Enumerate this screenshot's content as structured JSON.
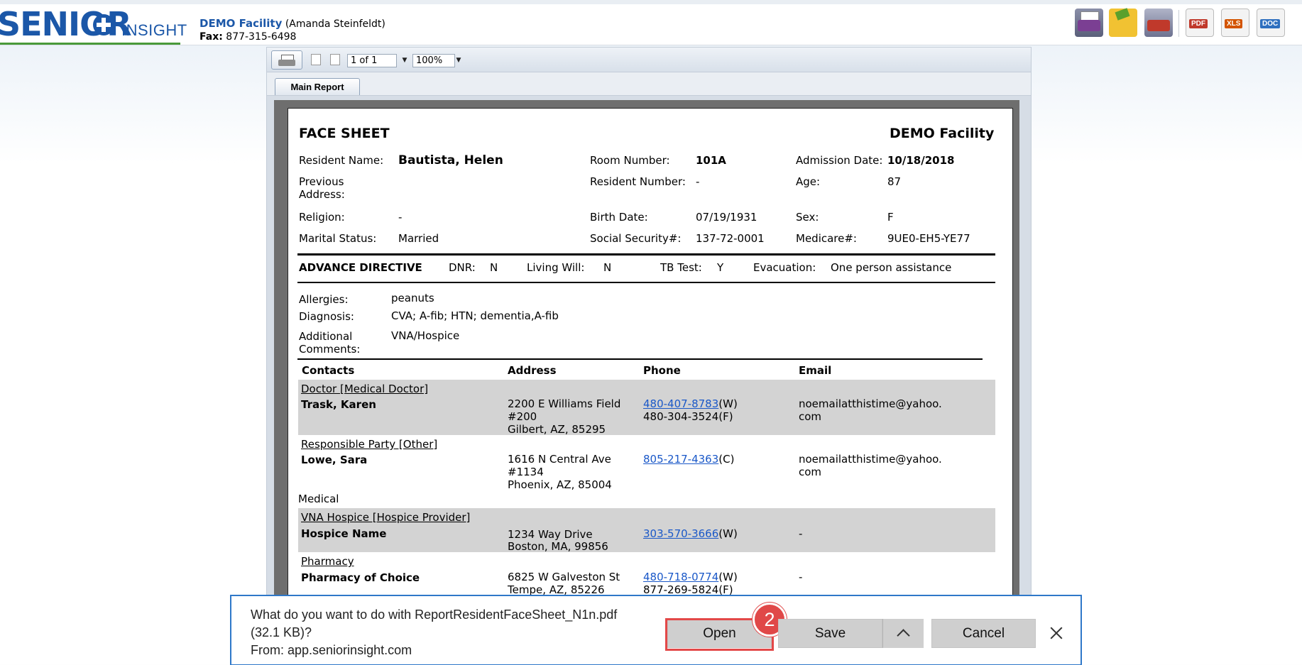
{
  "header": {
    "logo_main": "SENIOR",
    "logo_sub": "INSIGHT",
    "facility_name": "DEMO Facility",
    "facility_person": "(Amanda Steinfeldt)",
    "fax_label": "Fax:",
    "fax_number": "877-315-6498"
  },
  "toolbar_icons": [
    "printer-icon",
    "email-icon",
    "fax-icon",
    "pdf-icon",
    "xls-icon",
    "doc-icon"
  ],
  "export_labels": {
    "pdf": "PDF",
    "xls": "XLS",
    "doc": "DOC"
  },
  "viewer": {
    "page_value": "1 of 1",
    "zoom_value": "100%",
    "tab_label": "Main Report"
  },
  "report": {
    "title": "FACE SHEET",
    "facility": "DEMO Facility",
    "resident_name_label": "Resident Name:",
    "resident_name": "Bautista, Helen",
    "room_number_label": "Room Number:",
    "room_number": "101A",
    "admission_date_label": "Admission Date:",
    "admission_date": "10/18/2018",
    "previous_address_label": "Previous Address:",
    "resident_number_label": "Resident Number:",
    "resident_number": "-",
    "age_label": "Age:",
    "age": "87",
    "religion_label": "Religion:",
    "religion": "-",
    "birth_date_label": "Birth Date:",
    "birth_date": "07/19/1931",
    "sex_label": "Sex:",
    "sex": "F",
    "marital_status_label": "Marital Status:",
    "marital_status": "Married",
    "ssn_label": "Social Security#:",
    "ssn": "137-72-0001",
    "medicare_label": "Medicare#:",
    "medicare": "9UE0-EH5-YE77",
    "advance": {
      "heading": "ADVANCE DIRECTIVE",
      "dnr_label": "DNR:",
      "dnr": "N",
      "living_will_label": "Living Will:",
      "living_will": "N",
      "tb_test_label": "TB Test:",
      "tb_test": "Y",
      "evacuation_label": "Evacuation:",
      "evacuation": "One person assistance"
    },
    "allergies_label": "Allergies:",
    "allergies": "peanuts",
    "diagnosis_label": "Diagnosis:",
    "diagnosis": "CVA; A-fib; HTN; dementia,A-fib",
    "comments_label": "Additional Comments:",
    "comments": "VNA/Hospice",
    "contacts_headers": [
      "Contacts",
      "Address",
      "Phone",
      "Email"
    ],
    "contacts": [
      {
        "type": "Doctor [Medical Doctor]",
        "name": "Trask, Karen",
        "address": [
          "2200 E Williams Field",
          "#200",
          "Gilbert, AZ, 85295"
        ],
        "phone_link": "480-407-8783",
        "phone_link_suffix": "(W)",
        "phone_2": "480-304-3524(F)",
        "email": "noemailatthistime@yahoo.com"
      },
      {
        "type": "Responsible Party [Other]",
        "name": "Lowe, Sara",
        "address": [
          "1616 N Central Ave",
          "#1134",
          "Phoenix, AZ, 85004"
        ],
        "phone_link": "805-217-4363",
        "phone_link_suffix": "(C)",
        "phone_2": "",
        "email": "noemailatthistime@yahoo.com",
        "extra": "Medical"
      },
      {
        "type": "VNA Hospice [Hospice Provider]",
        "name": "Hospice Name",
        "address": [
          "1234 Way Drive",
          "Boston, MA, 99856"
        ],
        "phone_link": "303-570-3666",
        "phone_link_suffix": "(W)",
        "phone_2": "",
        "email": "-"
      },
      {
        "type": "Pharmacy",
        "name": "Pharmacy of Choice",
        "address": [
          "6825 W Galveston St",
          "Tempe, AZ, 85226"
        ],
        "phone_link": "480-718-0774",
        "phone_link_suffix": "(W)",
        "phone_2": "877-269-5824(F)",
        "email": "-"
      }
    ]
  },
  "download_bar": {
    "question_line1": "What do you want to do with ReportResidentFaceSheet_N1n.pdf",
    "question_line2": "(32.1 KB)?",
    "from_line": "From: app.seniorinsight.com",
    "open_label": "Open",
    "save_label": "Save",
    "cancel_label": "Cancel",
    "step_badge": "2"
  },
  "colors": {
    "brand_blue": "#1b57a8",
    "link_blue": "#1a58c8",
    "highlight_red": "#e34848",
    "row_gray": "#d3d3d3"
  }
}
